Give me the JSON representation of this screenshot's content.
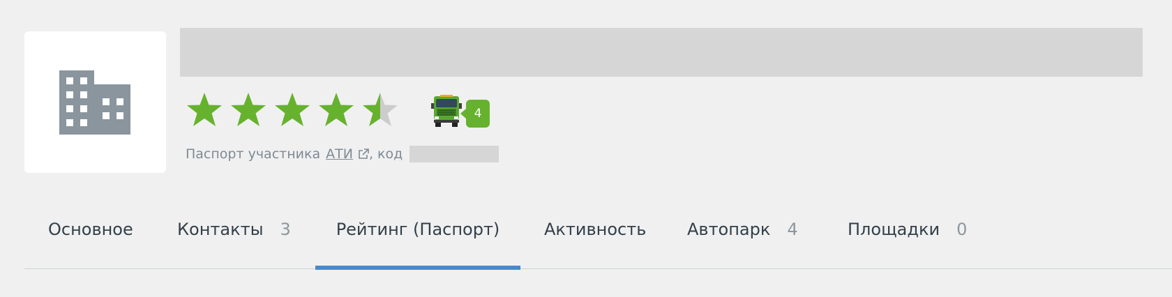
{
  "colors": {
    "star_filled": "#66b22e",
    "star_empty": "#cccccc",
    "active_tab_underline": "#4a89c8",
    "badge_bg": "#66b22e"
  },
  "profile": {
    "logo_icon": "building-icon",
    "rating_stars": 4.5,
    "rating_max": 5,
    "fleet_icon": "truck-icon",
    "fleet_count": "4"
  },
  "passport": {
    "prefix": "Паспорт участника",
    "link_label": "АТИ",
    "link_icon": "external-link-icon",
    "code_label": ", код"
  },
  "tabs": [
    {
      "label": "Основное",
      "count": ""
    },
    {
      "label": "Контакты",
      "count": "3"
    },
    {
      "label": "Рейтинг (Паспорт)",
      "count": "",
      "active": true
    },
    {
      "label": "Активность",
      "count": ""
    },
    {
      "label": "Автопарк",
      "count": "4"
    },
    {
      "label": "Площадки",
      "count": "0"
    }
  ]
}
